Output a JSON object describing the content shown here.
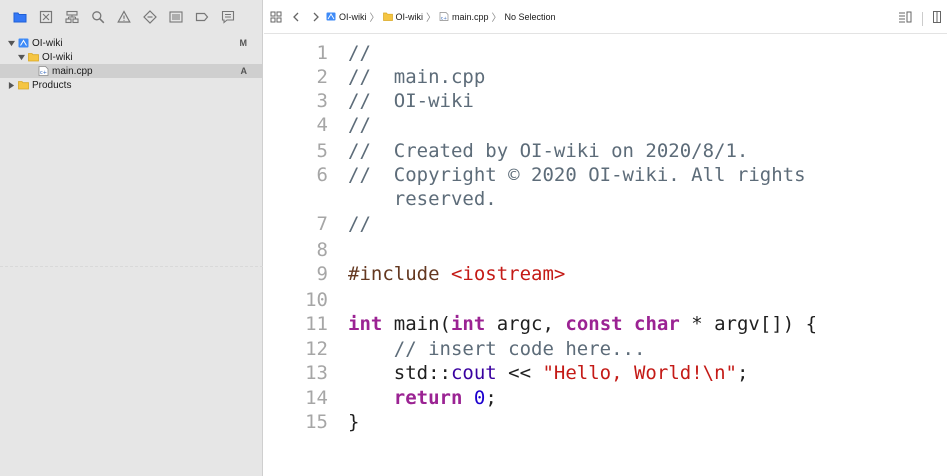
{
  "navigator": {
    "toolbar_icons": [
      "folder-icon",
      "source-control-icon",
      "hierarchy-icon",
      "find-icon",
      "issue-icon",
      "test-icon",
      "debug-icon",
      "breakpoint-icon",
      "report-icon"
    ],
    "tree": [
      {
        "label": "OI-wiki",
        "badge": "M",
        "kind": "project",
        "expanded": true,
        "indent": 0
      },
      {
        "label": "OI-wiki",
        "badge": "",
        "kind": "folder",
        "expanded": true,
        "indent": 1
      },
      {
        "label": "main.cpp",
        "badge": "A",
        "kind": "cpp-file",
        "indent": 2,
        "selected": true
      },
      {
        "label": "Products",
        "badge": "",
        "kind": "folder",
        "expanded": false,
        "indent": 1
      }
    ]
  },
  "jumpbar": {
    "crumbs": [
      "OI-wiki",
      "OI-wiki",
      "main.cpp",
      "No Selection"
    ]
  },
  "editor": {
    "lines": [
      {
        "n": "1",
        "parts": [
          {
            "t": "//",
            "c": "comment"
          }
        ]
      },
      {
        "n": "2",
        "parts": [
          {
            "t": "//  main.cpp",
            "c": "comment"
          }
        ]
      },
      {
        "n": "3",
        "parts": [
          {
            "t": "//  OI-wiki",
            "c": "comment"
          }
        ]
      },
      {
        "n": "4",
        "parts": [
          {
            "t": "//",
            "c": "comment"
          }
        ]
      },
      {
        "n": "5",
        "parts": [
          {
            "t": "//  Created by OI-wiki on 2020/8/1.",
            "c": "comment"
          }
        ]
      },
      {
        "n": "6",
        "parts": [
          {
            "t": "//  Copyright © 2020 OI-wiki. All rights",
            "c": "comment"
          }
        ]
      },
      {
        "n": "",
        "parts": [
          {
            "t": "    reserved.",
            "c": "comment"
          }
        ]
      },
      {
        "n": "7",
        "parts": [
          {
            "t": "//",
            "c": "comment"
          }
        ]
      },
      {
        "n": "8",
        "parts": []
      },
      {
        "n": "9",
        "parts": [
          {
            "t": "#include ",
            "c": "pre"
          },
          {
            "t": "<iostream>",
            "c": "str"
          }
        ]
      },
      {
        "n": "10",
        "parts": []
      },
      {
        "n": "11",
        "parts": [
          {
            "t": "int",
            "c": "kw"
          },
          {
            "t": " main(",
            "c": "plain"
          },
          {
            "t": "int",
            "c": "kw"
          },
          {
            "t": " argc, ",
            "c": "plain"
          },
          {
            "t": "const",
            "c": "kw"
          },
          {
            "t": " ",
            "c": "plain"
          },
          {
            "t": "char",
            "c": "kw"
          },
          {
            "t": " * argv[]) {",
            "c": "plain"
          }
        ]
      },
      {
        "n": "12",
        "parts": [
          {
            "t": "    ",
            "c": "plain"
          },
          {
            "t": "// insert code here...",
            "c": "comment"
          }
        ]
      },
      {
        "n": "13",
        "parts": [
          {
            "t": "    std::",
            "c": "plain"
          },
          {
            "t": "cout",
            "c": "type"
          },
          {
            "t": " << ",
            "c": "plain"
          },
          {
            "t": "\"Hello, World!\\n\"",
            "c": "str"
          },
          {
            "t": ";",
            "c": "plain"
          }
        ]
      },
      {
        "n": "14",
        "parts": [
          {
            "t": "    ",
            "c": "plain"
          },
          {
            "t": "return",
            "c": "kw"
          },
          {
            "t": " ",
            "c": "plain"
          },
          {
            "t": "0",
            "c": "num"
          },
          {
            "t": ";",
            "c": "plain"
          }
        ]
      },
      {
        "n": "15",
        "parts": [
          {
            "t": "}",
            "c": "plain"
          }
        ]
      }
    ]
  }
}
